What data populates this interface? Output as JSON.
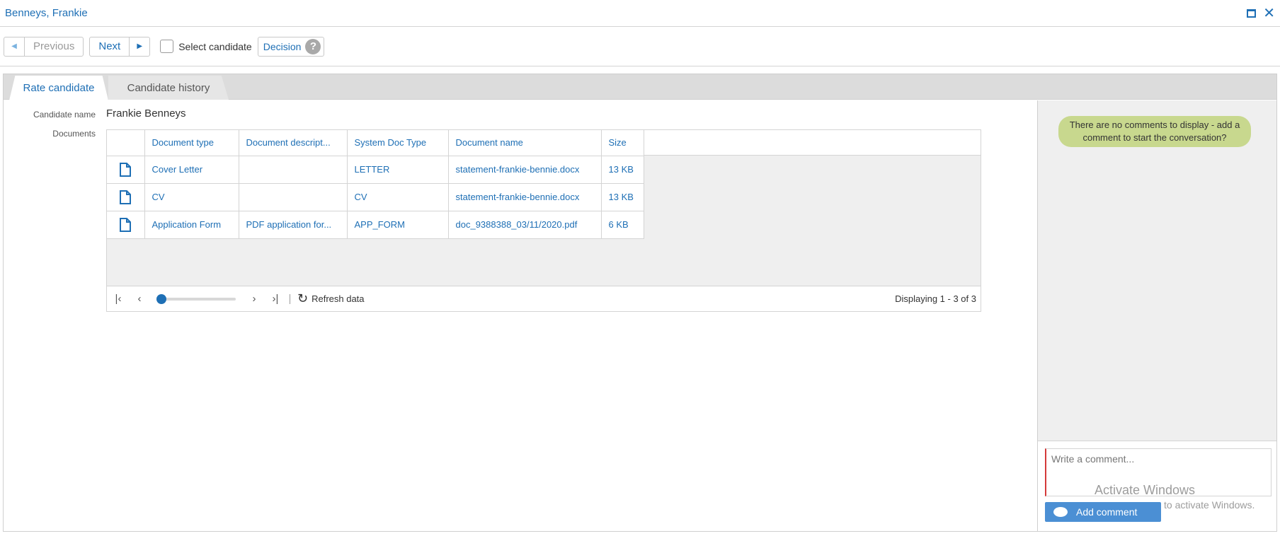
{
  "window": {
    "title": "Benneys, Frankie",
    "maximize_icon": "maximize-icon",
    "close_icon": "close-icon"
  },
  "toolbar": {
    "previous_label": "Previous",
    "next_label": "Next",
    "select_candidate_label": "Select candidate",
    "select_candidate_checked": false,
    "decision_label": "Decision",
    "help_glyph": "?"
  },
  "tabs": [
    {
      "label": "Rate candidate",
      "active": true
    },
    {
      "label": "Candidate history",
      "active": false
    }
  ],
  "form": {
    "candidate_name_label": "Candidate name",
    "candidate_name_value": "Frankie Benneys",
    "documents_label": "Documents"
  },
  "documents_grid": {
    "columns": [
      "Document type",
      "Document descript...",
      "System Doc Type",
      "Document name",
      "Size"
    ],
    "rows": [
      {
        "type": "Cover Letter",
        "description": "",
        "system_type": "LETTER",
        "name": "statement-frankie-bennie.docx",
        "size": "13 KB"
      },
      {
        "type": "CV",
        "description": "",
        "system_type": "CV",
        "name": "statement-frankie-bennie.docx",
        "size": "13 KB"
      },
      {
        "type": "Application Form",
        "description": "PDF application for...",
        "system_type": "APP_FORM",
        "name": "doc_9388388_03/11/2020.pdf",
        "size": "6 KB"
      }
    ],
    "pager": {
      "refresh_label": "Refresh data",
      "display_text": "Displaying 1 - 3 of 3"
    }
  },
  "comments": {
    "empty_message": "There are no comments to display - add a comment to start the conversation?",
    "input_placeholder": "Write a comment...",
    "add_button_label": "Add comment"
  },
  "os_watermark": {
    "line1": "Activate Windows",
    "line2": "to activate Windows."
  },
  "colors": {
    "accent": "#1e6fb5",
    "bubble": "#c8d88e",
    "add_button": "#4b8fd4"
  }
}
